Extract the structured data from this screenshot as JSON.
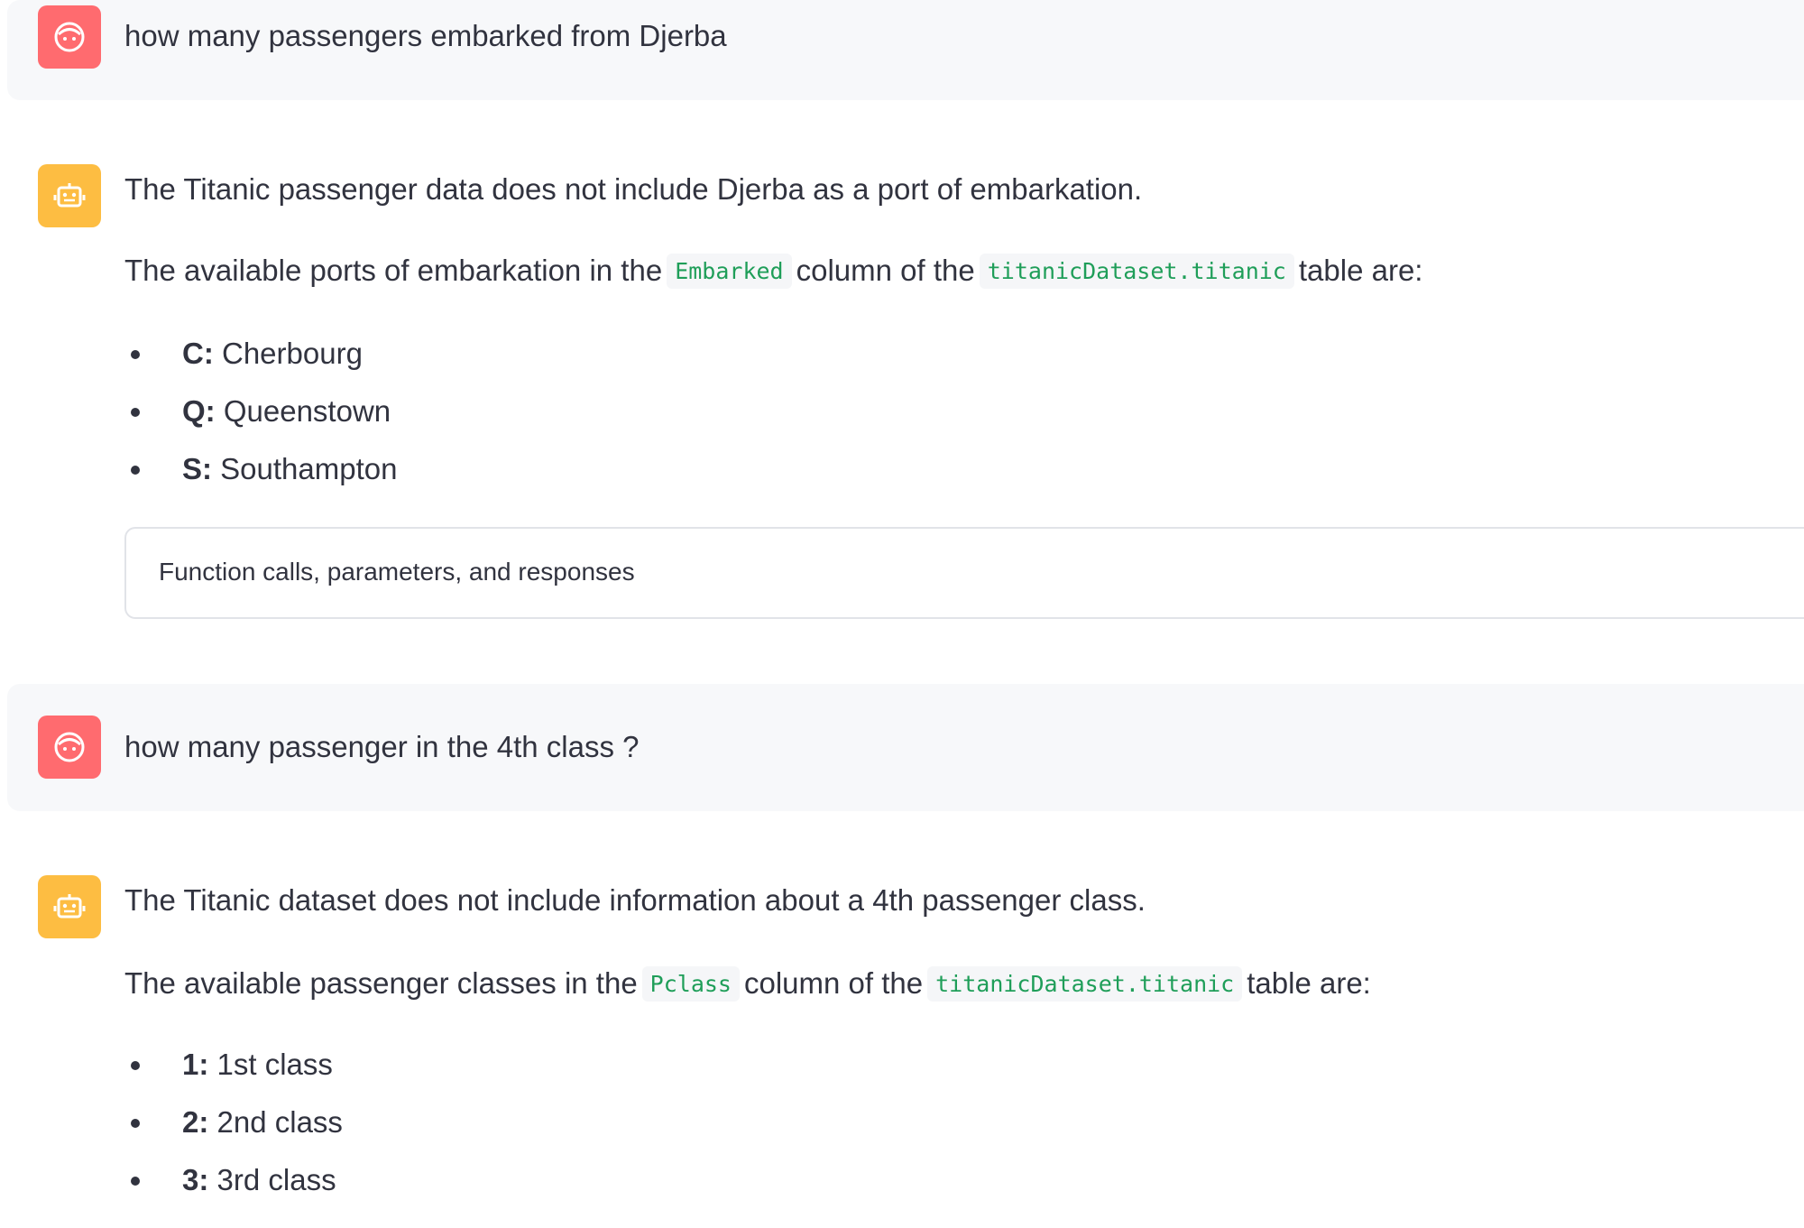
{
  "messages": [
    {
      "role": "user",
      "text": "how many passengers embarked from Djerba"
    },
    {
      "role": "assistant",
      "intro": "The Titanic passenger data does not include Djerba as a port of embarkation.",
      "line2": {
        "pre": "The available ports of embarkation in the",
        "code1": "Embarked",
        "mid": "column of the",
        "code2": "titanicDataset.titanic",
        "post": "table are:"
      },
      "bullets": [
        {
          "key": "C:",
          "value": "Cherbourg"
        },
        {
          "key": "Q:",
          "value": "Queenstown"
        },
        {
          "key": "S:",
          "value": "Southampton"
        }
      ],
      "expander_label": "Function calls, parameters, and responses"
    },
    {
      "role": "user",
      "text": "how many passenger in the 4th class ?"
    },
    {
      "role": "assistant",
      "intro": "The Titanic dataset does not include information about a 4th passenger class.",
      "line2": {
        "pre": "The available passenger classes in the",
        "code1": "Pclass",
        "mid": "column of the",
        "code2": "titanicDataset.titanic",
        "post": "table are:"
      },
      "bullets": [
        {
          "key": "1:",
          "value": "1st class"
        },
        {
          "key": "2:",
          "value": "2nd class"
        },
        {
          "key": "3:",
          "value": "3rd class"
        }
      ]
    }
  ],
  "icons": {
    "user_avatar": "user-face-icon",
    "assistant_avatar": "robot-icon"
  },
  "colors": {
    "user_avatar_bg": "#ff6b6f",
    "assistant_avatar_bg": "#fdbd42",
    "code_text": "#1f9e59",
    "user_message_bg": "#f7f8fa"
  }
}
